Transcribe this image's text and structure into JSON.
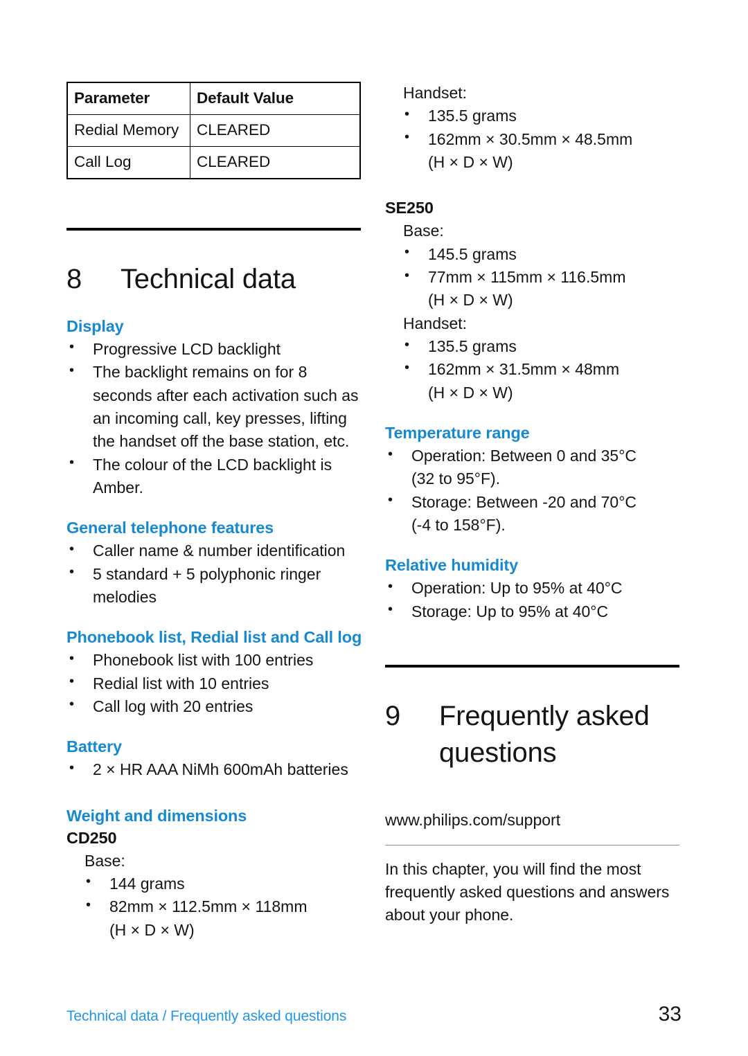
{
  "document": {
    "page_number": "33",
    "footer_breadcrumb": "Technical data / Frequently asked questions",
    "accent_color": "#1789cf",
    "footer_color": "#2196e3"
  },
  "table": {
    "headers": [
      "Parameter",
      "Default Value"
    ],
    "rows": [
      {
        "parameter": "Redial Memory",
        "value": "CLEARED"
      },
      {
        "parameter": "Call Log",
        "value": "CLEARED"
      }
    ]
  },
  "chapter8": {
    "number": "8",
    "title": "Technical data",
    "display": {
      "heading": "Display",
      "bullets": [
        "Progressive LCD backlight",
        "The backlight remains on for 8 seconds after each activation such as an incoming call, key presses, lifting the handset off the base station, etc.",
        "The colour of the LCD backlight is Amber."
      ]
    },
    "general_features": {
      "heading": "General telephone features",
      "bullets": [
        "Caller name & number identification",
        "5 standard + 5 polyphonic ringer melodies"
      ]
    },
    "lists": {
      "heading": "Phonebook list, Redial list and Call log",
      "bullets": [
        "Phonebook list with 100 entries",
        "Redial list with 10 entries",
        "Call log with 20 entries"
      ]
    },
    "battery": {
      "heading": "Battery",
      "bullets": [
        "2 × HR AAA NiMh 600mAh batteries"
      ]
    },
    "weight": {
      "heading": "Weight and dimensions",
      "models": [
        {
          "name": "CD250",
          "groups": [
            {
              "label": "Base:",
              "bullets": [
                "144 grams",
                "82mm × 112.5mm × 118mm"
              ],
              "bullet_continuations": [
                "",
                "(H × D × W)"
              ]
            },
            {
              "label": "Handset:",
              "bullets": [
                "135.5 grams",
                "162mm × 30.5mm × 48.5mm"
              ],
              "bullet_continuations": [
                "",
                "(H × D × W)"
              ]
            }
          ]
        },
        {
          "name": "SE250",
          "groups": [
            {
              "label": "Base:",
              "bullets": [
                "145.5 grams",
                "77mm × 115mm × 116.5mm"
              ],
              "bullet_continuations": [
                "",
                "(H × D × W)"
              ]
            },
            {
              "label": "Handset:",
              "bullets": [
                "135.5 grams",
                "162mm × 31.5mm × 48mm"
              ],
              "bullet_continuations": [
                "",
                "(H × D × W)"
              ]
            }
          ]
        }
      ]
    },
    "temperature": {
      "heading": "Temperature range",
      "bullets": [
        "Operation: Between 0 and 35°C (32 to 95°F).",
        "Storage: Between -20 and 70°C (-4 to 158°F)."
      ],
      "bullet_lines": [
        [
          "Operation: Between 0 and 35°C",
          "(32 to 95°F)."
        ],
        [
          "Storage: Between -20 and 70°C",
          "(-4 to 158°F)."
        ]
      ]
    },
    "humidity": {
      "heading": "Relative humidity",
      "bullets": [
        "Operation: Up to 95% at 40°C",
        "Storage: Up to 95% at 40°C"
      ]
    }
  },
  "chapter9": {
    "number": "9",
    "title_line1": "Frequently asked",
    "title_line2": "questions",
    "url": "www.philips.com/support",
    "intro": "In this chapter, you will find the most frequently asked questions and answers about your phone."
  }
}
